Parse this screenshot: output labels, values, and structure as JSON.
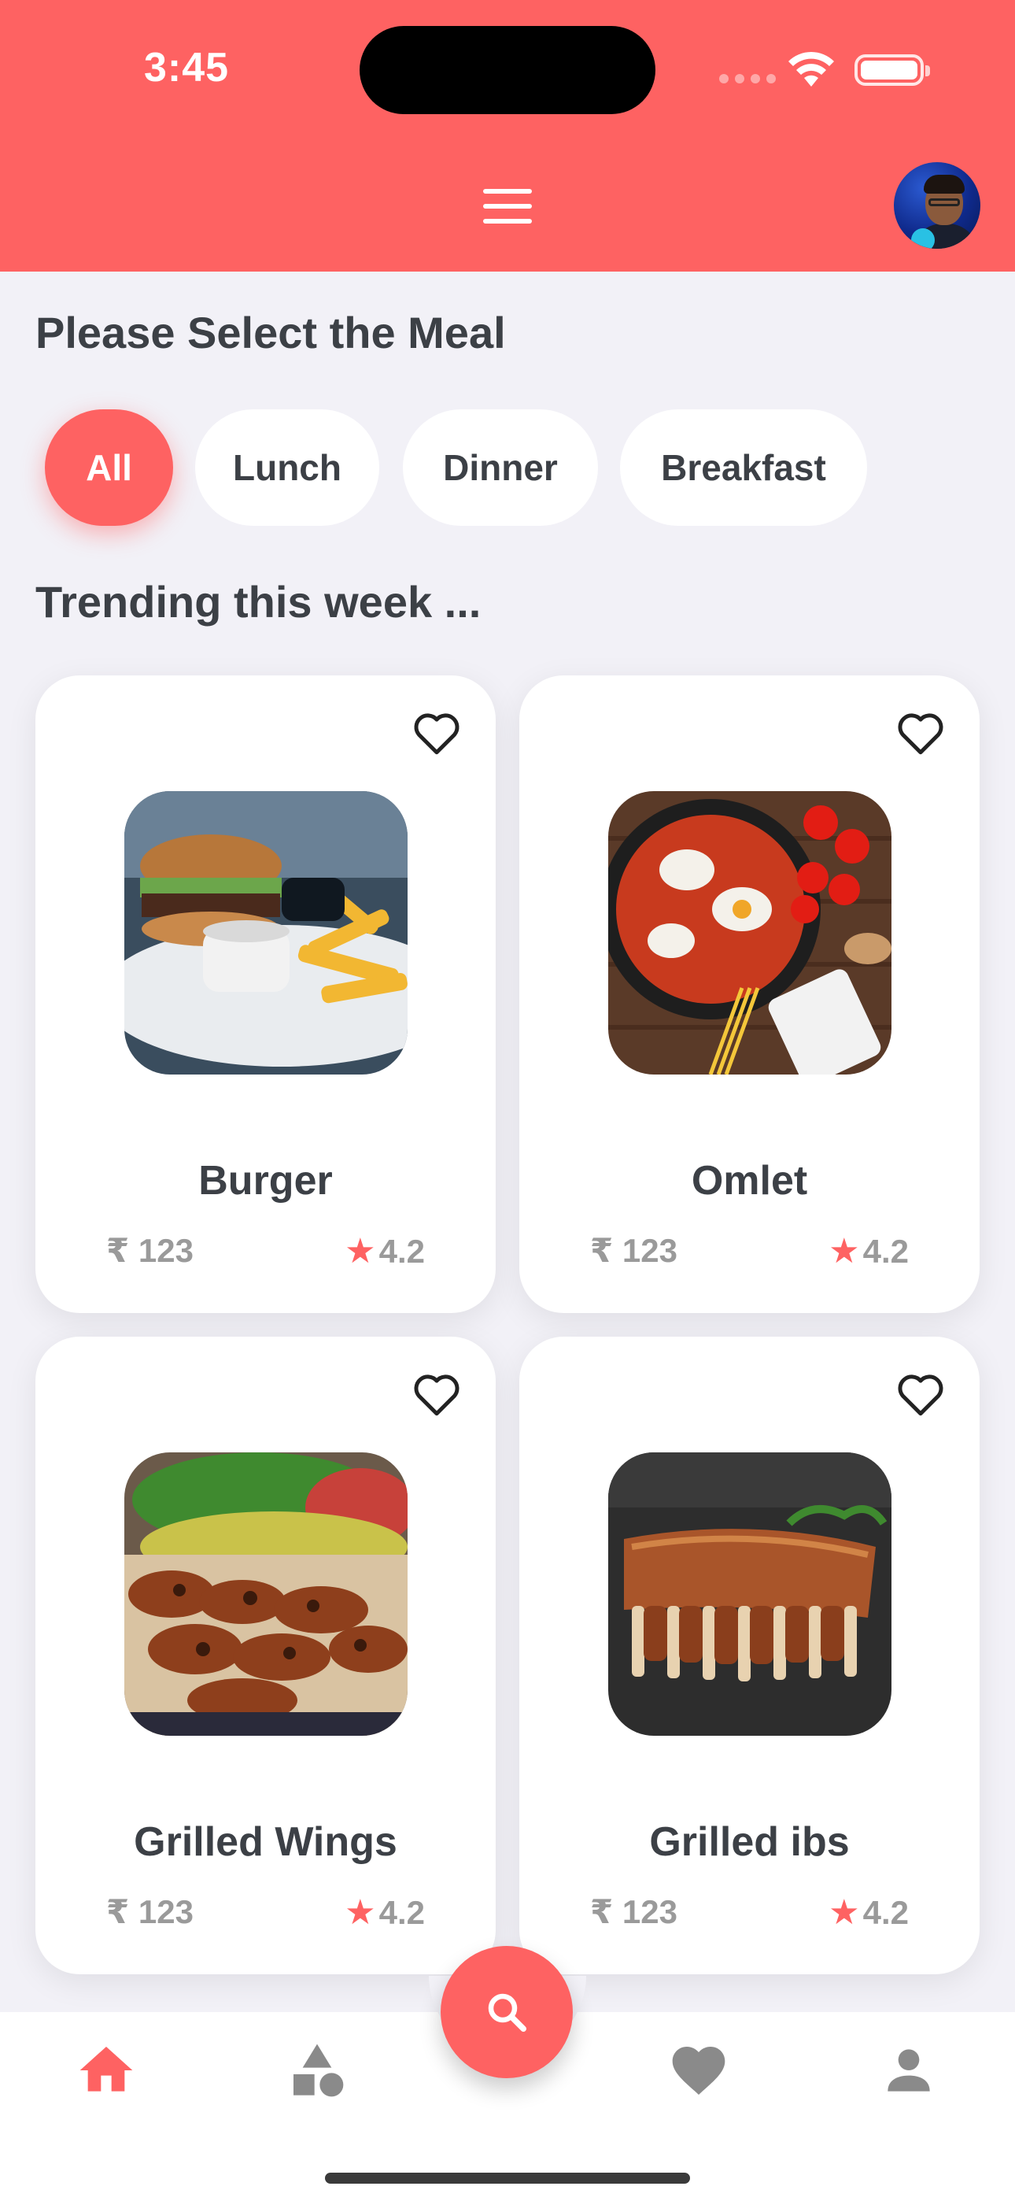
{
  "status_bar": {
    "time": "3:45"
  },
  "header": {
    "menu_icon": "hamburger-menu-icon",
    "avatar": "user-avatar"
  },
  "sections": {
    "select_title": "Please Select the Meal",
    "trending_title": "Trending this week ..."
  },
  "filters": [
    {
      "label": "All",
      "active": true
    },
    {
      "label": "Lunch",
      "active": false
    },
    {
      "label": "Dinner",
      "active": false
    },
    {
      "label": "Breakfast",
      "active": false
    }
  ],
  "meals": [
    {
      "name": "Burger",
      "price": "₹ 123",
      "rating": "4.2"
    },
    {
      "name": "Omlet",
      "price": "₹ 123",
      "rating": "4.2"
    },
    {
      "name": "Grilled Wings",
      "price": "₹ 123",
      "rating": "4.2"
    },
    {
      "name": "Grilled ibs",
      "price": "₹ 123",
      "rating": "4.2"
    }
  ],
  "bottom_nav": {
    "items": [
      "home-icon",
      "categories-icon",
      "search-icon",
      "favorites-icon",
      "profile-icon"
    ],
    "active": "home-icon"
  },
  "colors": {
    "accent": "#fe6262",
    "background": "#f2f1f7",
    "text": "#3c4046",
    "muted": "#9a9a9a"
  }
}
